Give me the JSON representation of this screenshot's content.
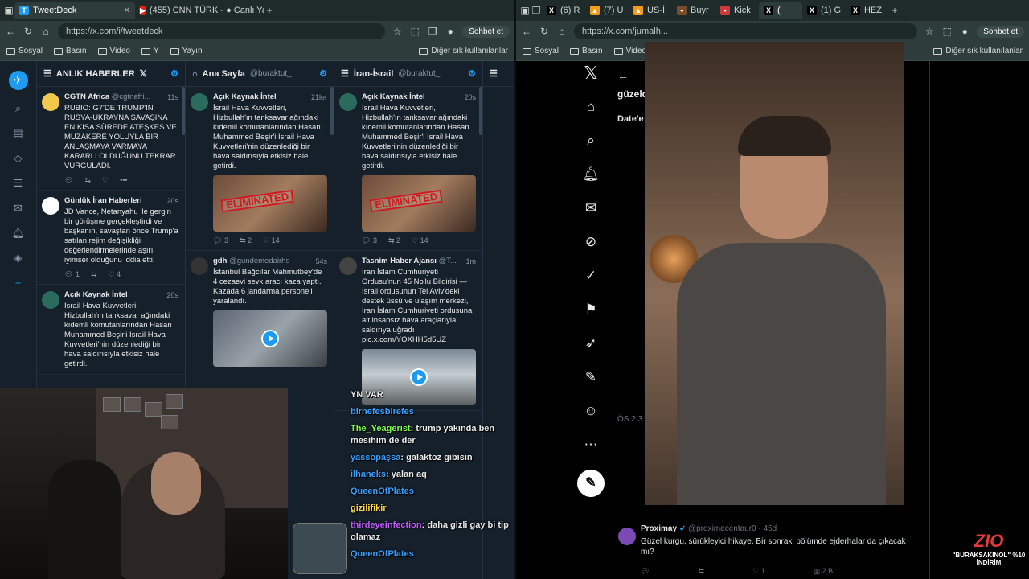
{
  "left_browser": {
    "tabs": [
      {
        "label": "TweetDeck",
        "active": true
      },
      {
        "label": "(455) CNN TÜRK - ● Canlı Yayın",
        "active": false
      }
    ],
    "url": "https://x.com/i/tweetdeck",
    "chat_button": "Sohbet et",
    "bookmarks": [
      "Sosyal",
      "Basın",
      "Video",
      "Y",
      "Yayın"
    ],
    "bookmarks_other": "Diğer sık kullanılanlar"
  },
  "right_browser": {
    "tabs": [
      "(6) R",
      "(7) U",
      "US-İ",
      "Buyr",
      "Kick",
      "(",
      "(1) G",
      "HEZ"
    ],
    "url": "https://x.com/jumalh...",
    "chat_button": "Sohbet et",
    "bookmarks": [
      "Sosyal",
      "Basın",
      "Video"
    ],
    "bookmarks_other": "Diğer sık kullanılanlar"
  },
  "columns": [
    {
      "title": "ANLIK HABERLER",
      "handle": "",
      "tweets": [
        {
          "name": "CGTN Africa",
          "handle": "@cgtnafri...",
          "time": "11s",
          "body": "RUBIO: G7'DE TRUMP'IN RUSYA-UKRAYNA SAVAŞINA EN KISA SÜREDE ATEŞKES VE MÜZAKERE YOLUYLA BİR ANLAŞMAYA VARMAYA KARARLI OLDUĞUNU TEKRAR VURGULADI.",
          "acts": [
            "",
            "",
            ""
          ]
        },
        {
          "name": "Günlük İran Haberleri",
          "handle": "",
          "time": "20s",
          "body": "JD Vance, Netanyahu ile gergin bir görüşme gerçekleştirdi ve başkanın, savaştan önce Trump'a satılan rejim değişikliği değerlendirmelerinde aşırı iyimser olduğunu iddia etti.",
          "acts": [
            "1",
            "",
            "4"
          ]
        },
        {
          "name": "Açık Kaynak İntel",
          "handle": "",
          "time": "20s",
          "body": "İsrail Hava Kuvvetleri, Hizbullah'ın tanksavar ağındaki kıdemli komutanlarından Hasan Muhammed Beşir'i İsrail Hava Kuvvetleri'nin düzenlediği bir hava saldırısıyla etkisiz hale getirdi.",
          "acts": [
            "",
            "",
            ""
          ]
        }
      ]
    },
    {
      "title": "Ana Sayfa",
      "handle": "@buraktut_",
      "tweets": [
        {
          "name": "Açık Kaynak İntel",
          "handle": "",
          "time": "21ler",
          "body": "İsrail Hava Kuvvetleri, Hizbullah'ın tanksavar ağındaki kıdemli komutanlarından Hasan Muhammed Beşir'i İsrail Hava Kuvvetleri'nin düzenlediği bir hava saldırısıyla etkisiz hale getirdi.",
          "media": "ELIMINATED",
          "acts": [
            "3",
            "2",
            "14"
          ]
        },
        {
          "name": "gdh",
          "handle": "@gundemedairhs",
          "time": "54s",
          "body": "İstanbul Bağcılar Mahmutbey'de 4 cezaevi sevk aracı kaza yaptı. Kazada 6 jandarma personeli yaralandı.",
          "video": true,
          "acts": [
            "",
            "",
            ""
          ]
        }
      ]
    },
    {
      "title": "İran-İsrail",
      "handle": "@buraktut_",
      "tweets": [
        {
          "name": "Açık Kaynak İntel",
          "handle": "",
          "time": "20s",
          "body": "İsrail Hava Kuvvetleri, Hizbullah'ın tanksavar ağındaki kıdemli komutanlarından Hasan Muhammed Beşir'i İsrail Hava Kuvvetleri'nin düzenlediği bir hava saldırısıyla etkisiz hale getirdi.",
          "media": "ELIMINATED",
          "acts": [
            "3",
            "2",
            "14"
          ]
        },
        {
          "name": "Tasnim Haber Ajansı",
          "handle": "@T...",
          "time": "1m",
          "body": "İran İslam Cumhuriyeti Ordusu'nun 45 No'lu Bildirisi — İsrail ordusunun Tel Aviv'deki destek üssü ve ulaşım merkezi, İran İslam Cumhuriyeti ordusuna ait insansız hava araçlarıyla saldırıya uğradı pic.x.com/YOXHH5d5UZ",
          "video": true,
          "acts": [
            "",
            "",
            ""
          ]
        }
      ]
    }
  ],
  "chat": [
    {
      "user": "",
      "msg": "YN VAR",
      "color": "#ffffff"
    },
    {
      "user": "birnefesbirefes",
      "msg": "",
      "color": "#3aa0ff"
    },
    {
      "user": "The_Yeagerist",
      "msg": "trump yakında ben mesihim de der",
      "color": "#7bff4a"
    },
    {
      "user": "yassopaşsa",
      "msg": "galaktoz gibisin",
      "color": "#3aa0ff"
    },
    {
      "user": "ilhaneks",
      "msg": "yalan aq",
      "color": "#3aa0ff"
    },
    {
      "user": "QueenOfPlates",
      "msg": "",
      "color": "#3aa0ff"
    },
    {
      "user": "gizilifikir",
      "msg": "",
      "color": "#ffd84a"
    },
    {
      "user": "thirdeyeinfection",
      "msg": "daha gizli gay bi tip olamaz",
      "color": "#c15cff"
    },
    {
      "user": "QueenOfPlates",
      "msg": "",
      "color": "#3aa0ff"
    }
  ],
  "x_page": {
    "header_text": "güzeld",
    "date_text": "Date'e",
    "time_text": "ÖS 2:3",
    "reply": {
      "name": "Proximay",
      "handle": "@proximacentaur0 · 45d",
      "body": "Güzel kurgu, sürükleyici hikaye. Bir sonraki bölümde ejderhalar da çıkacak mı?",
      "acts": [
        "",
        "",
        "1",
        "2 B"
      ]
    }
  },
  "promo": {
    "logo": "ZIO",
    "text": "\"BURAKSAKİNOL\" %10 İNDİRİM"
  }
}
